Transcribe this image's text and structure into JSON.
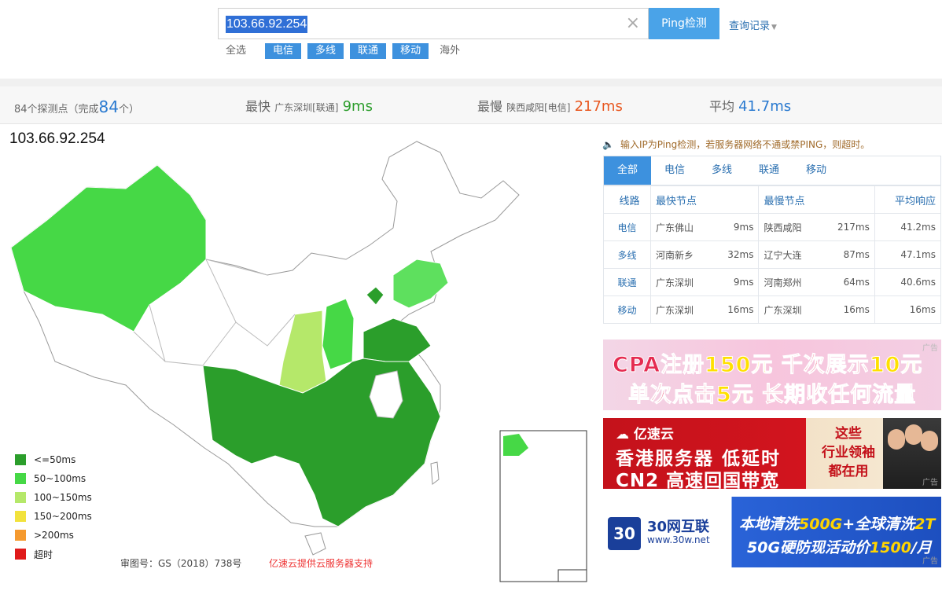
{
  "search": {
    "value": "103.66.92.254",
    "button_label": "Ping检测",
    "history_label": "查询记录"
  },
  "filters": {
    "all": "全选",
    "telecom": "电信",
    "multi": "多线",
    "unicom": "联通",
    "mobile": "移动",
    "overseas": "海外"
  },
  "stats": {
    "probe_prefix": "84个探测点（完成",
    "probe_count": "84",
    "probe_suffix": "个）",
    "fastest_label": "最快",
    "fastest_node": "广东深圳[联通]",
    "fastest_value": "9ms",
    "slowest_label": "最慢",
    "slowest_node": "陕西咸阳[电信]",
    "slowest_value": "217ms",
    "avg_label": "平均",
    "avg_value": "41.7ms"
  },
  "map": {
    "ip_label": "103.66.92.254",
    "review_number": "审图号：GS（2018）738号",
    "sponsor_text": "亿速云提供云服务器支持"
  },
  "legend": [
    {
      "label": "<=50ms",
      "color": "#2b9e2b"
    },
    {
      "label": "50~100ms",
      "color": "#46d846"
    },
    {
      "label": "100~150ms",
      "color": "#b5e86a"
    },
    {
      "label": "150~200ms",
      "color": "#f2e23c"
    },
    {
      "label": ">200ms",
      "color": "#f59a2f"
    },
    {
      "label": "超时",
      "color": "#e01a1a"
    }
  ],
  "notice": "输入IP为Ping检测，若服务器网络不通或禁PING，则超时。",
  "tabs": [
    "全部",
    "电信",
    "多线",
    "联通",
    "移动"
  ],
  "table": {
    "headers": {
      "line": "线路",
      "fastest": "最快节点",
      "slowest": "最慢节点",
      "avg": "平均响应"
    },
    "rows": [
      {
        "line": "电信",
        "fast_node": "广东佛山",
        "fast_ms": "9ms",
        "slow_node": "陕西咸阳",
        "slow_ms": "217ms",
        "avg": "41.2ms"
      },
      {
        "line": "多线",
        "fast_node": "河南新乡",
        "fast_ms": "32ms",
        "slow_node": "辽宁大连",
        "slow_ms": "87ms",
        "avg": "47.1ms"
      },
      {
        "line": "联通",
        "fast_node": "广东深圳",
        "fast_ms": "9ms",
        "slow_node": "河南郑州",
        "slow_ms": "64ms",
        "avg": "40.6ms"
      },
      {
        "line": "移动",
        "fast_node": "广东深圳",
        "fast_ms": "16ms",
        "slow_node": "广东深圳",
        "slow_ms": "16ms",
        "avg": "16ms"
      }
    ]
  },
  "ads": {
    "tag": "广告",
    "ad1": {
      "l1_a": "CPA注册",
      "l1_b": "150元",
      "l1_c": " 千次展示",
      "l1_d": "10元",
      "l2_a": "单次点击",
      "l2_b": "5元",
      "l2_c": " 长期收任何流量"
    },
    "ad2": {
      "brand": "亿速云",
      "l1": "香港服务器 低延时",
      "l2": "CN2 高速回国带宽",
      "r1": "这些",
      "r2": "行业领袖",
      "r3": "都在用"
    },
    "ad3": {
      "logo": "30",
      "brand": "30网互联",
      "site": "www.30w.net",
      "l1_a": "本地清洗",
      "l1_b": "500G",
      "l1_c": "+全球清洗",
      "l1_d": "2T",
      "l2_a": "50G硬防现活动价",
      "l2_b": "1500",
      "l2_c": "/月"
    }
  }
}
